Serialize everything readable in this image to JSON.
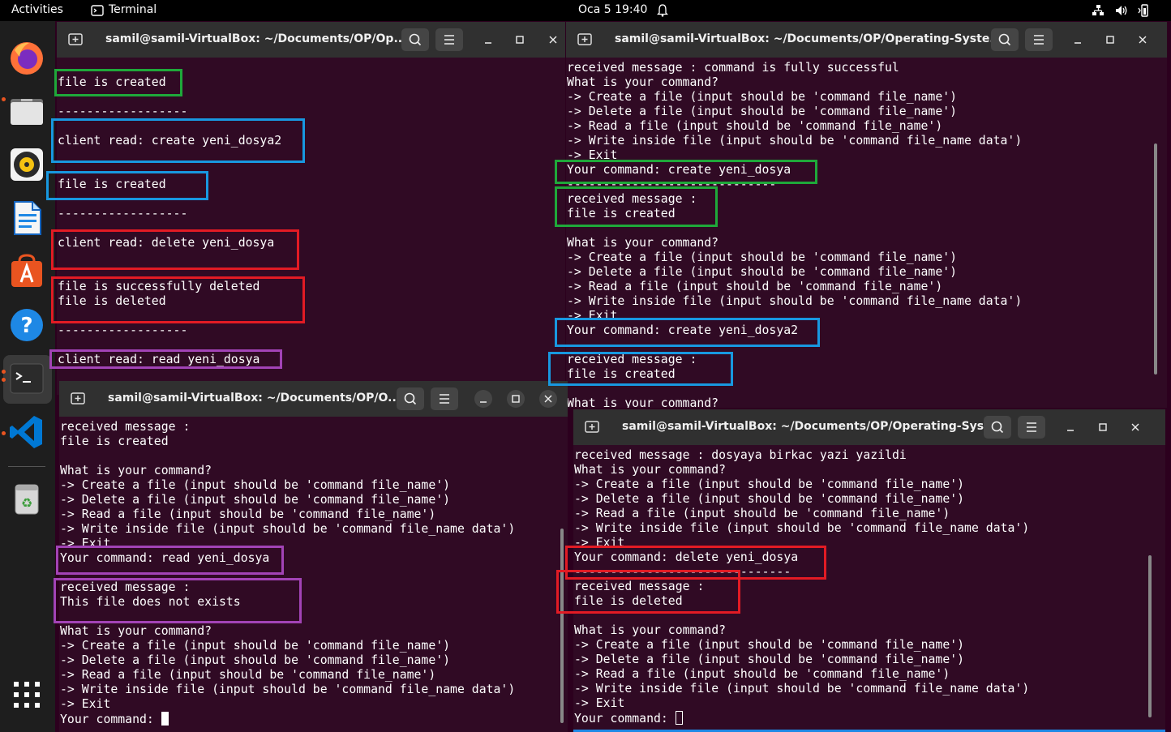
{
  "topbar": {
    "activities": "Activities",
    "app_name": "Terminal",
    "clock": "Oca 5  19:40"
  },
  "dock": {
    "apps": [
      "firefox-icon",
      "files-icon",
      "rhythmbox-icon",
      "writer-icon",
      "software-icon",
      "help-icon",
      "terminal-icon",
      "vscode-icon",
      "trash-icon",
      "app-grid-icon"
    ]
  },
  "windows": {
    "top_left": {
      "title": "samil@samil-VirtualBox: ~/Documents/OP/Op...",
      "lines": [
        "file is created",
        "",
        "------------------",
        "",
        "client read: create yeni_dosya2",
        "",
        "",
        "file is created",
        "",
        "------------------",
        "",
        "client read: delete yeni_dosya",
        "",
        "",
        "file is successfully deleted",
        "file is deleted",
        "",
        "------------------",
        "",
        "client read: read yeni_dosya"
      ]
    },
    "top_right": {
      "title": "samil@samil-VirtualBox: ~/Documents/OP/Operating-Syste...",
      "lines": [
        "received message : command is fully successful",
        "What is your command?",
        "-> Create a file (input should be 'command file_name')",
        "-> Delete a file (input should be 'command file_name')",
        "-> Read a file (input should be 'command file_name')",
        "-> Write inside file (input should be 'command file_name data')",
        "-> Exit",
        "Your command: create yeni_dosya",
        "-----------------------------",
        "received message :",
        "file is created",
        "",
        "What is your command?",
        "-> Create a file (input should be 'command file_name')",
        "-> Delete a file (input should be 'command file_name')",
        "-> Read a file (input should be 'command file_name')",
        "-> Write inside file (input should be 'command file_name data')",
        "-> Exit",
        "Your command: create yeni_dosya2",
        "",
        "received message :",
        "file is created",
        "",
        "What is your command?"
      ]
    },
    "bottom_left": {
      "title": "samil@samil-VirtualBox: ~/Documents/OP/O...",
      "lines": [
        "received message :",
        "file is created",
        "",
        "What is your command?",
        "-> Create a file (input should be 'command file_name')",
        "-> Delete a file (input should be 'command file_name')",
        "-> Read a file (input should be 'command file_name')",
        "-> Write inside file (input should be 'command file_name data')",
        "-> Exit",
        "Your command: read yeni_dosya",
        "",
        "received message :",
        "This file does not exists",
        "",
        "What is your command?",
        "-> Create a file (input should be 'command file_name')",
        "-> Delete a file (input should be 'command file_name')",
        "-> Read a file (input should be 'command file_name')",
        "-> Write inside file (input should be 'command file_name data')",
        "-> Exit"
      ],
      "prompt": "Your command: "
    },
    "bottom_right": {
      "title": "samil@samil-VirtualBox: ~/Documents/OP/Operating-Syst...",
      "lines": [
        "received message : dosyaya birkac yazi yazildi",
        "What is your command?",
        "-> Create a file (input should be 'command file_name')",
        "-> Delete a file (input should be 'command file_name')",
        "-> Read a file (input should be 'command file_name')",
        "-> Write inside file (input should be 'command file_name data')",
        "-> Exit",
        "Your command: delete yeni_dosya",
        "------------------------------",
        "received message :",
        "file is deleted",
        "",
        "What is your command?",
        "-> Create a file (input should be 'command file_name')",
        "-> Delete a file (input should be 'command file_name')",
        "-> Read a file (input should be 'command file_name')",
        "-> Write inside file (input should be 'command file_name data')",
        "-> Exit"
      ],
      "prompt": "Your command: "
    }
  },
  "annotation_colors": {
    "green": "#1fa83a",
    "blue": "#1898e0",
    "red": "#e21b24",
    "purple": "#a243b6"
  }
}
